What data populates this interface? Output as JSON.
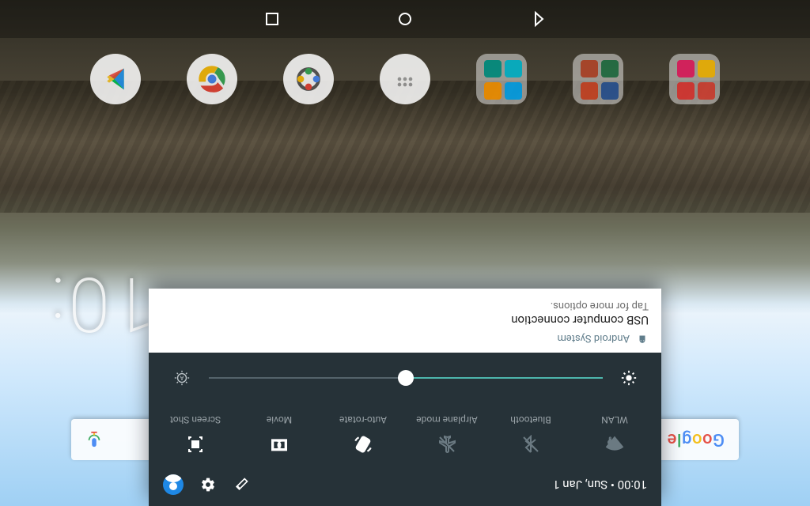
{
  "header": {
    "time": "10:00",
    "date": "Sun, Jan 1",
    "separator": " • "
  },
  "quick_settings": {
    "tiles": [
      {
        "label": "WLAN",
        "icon": "wifi-unknown-icon",
        "active": false
      },
      {
        "label": "Bluetooth",
        "icon": "bluetooth-off-icon",
        "active": false
      },
      {
        "label": "Airplane mode",
        "icon": "airplane-off-icon",
        "active": false
      },
      {
        "label": "Auto-rotate",
        "icon": "auto-rotate-icon",
        "active": true
      },
      {
        "label": "Movie",
        "icon": "dolby-icon",
        "active": true
      },
      {
        "label": "Screen Shot",
        "icon": "screenshot-icon",
        "active": true
      }
    ],
    "brightness_percent": 50
  },
  "notification": {
    "app_name": "Android System",
    "title": "USB computer connection",
    "subtitle": "Tap for more options."
  },
  "home": {
    "search_placeholder": "Google",
    "wall_clock": "10:"
  },
  "colors": {
    "panel_bg": "#263238",
    "tile_inactive": "#6b7a82",
    "slider_accent": "#4db6ac",
    "notif_app": "#607d8b"
  }
}
